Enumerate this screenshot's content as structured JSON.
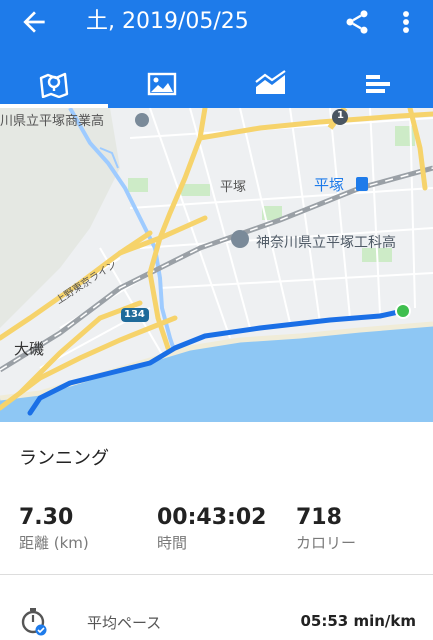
{
  "header": {
    "title": "土, 2019/05/25",
    "back_icon": "arrow-back-icon",
    "share_icon": "share-icon",
    "more_icon": "more-vert-icon"
  },
  "tabs": [
    {
      "icon": "map-icon",
      "selected": true
    },
    {
      "icon": "photo-icon",
      "selected": false
    },
    {
      "icon": "chart-icon",
      "selected": false
    },
    {
      "icon": "bars-icon",
      "selected": false
    }
  ],
  "map": {
    "labels": {
      "school1": "川県立平塚商業高",
      "hiratsuka_area": "平塚",
      "hiratsuka_station": "平塚",
      "school2": "神奈川県立平塚工科高",
      "oiso": "大磯",
      "railway": "上野東京ライン",
      "route_number": "134",
      "road_number": "1"
    }
  },
  "activity": {
    "type": "ランニング"
  },
  "stats": [
    {
      "value": "7.30",
      "label": "距離 (km)"
    },
    {
      "value": "00:43:02",
      "label": "時間"
    },
    {
      "value": "718",
      "label": "カロリー"
    }
  ],
  "pace": {
    "label": "平均ペース",
    "value": "05:53 min/km",
    "icon": "stopwatch-icon"
  },
  "colors": {
    "accent": "#1e7bea",
    "route": "#1a6fe6",
    "end_marker": "#3fbf4f"
  }
}
